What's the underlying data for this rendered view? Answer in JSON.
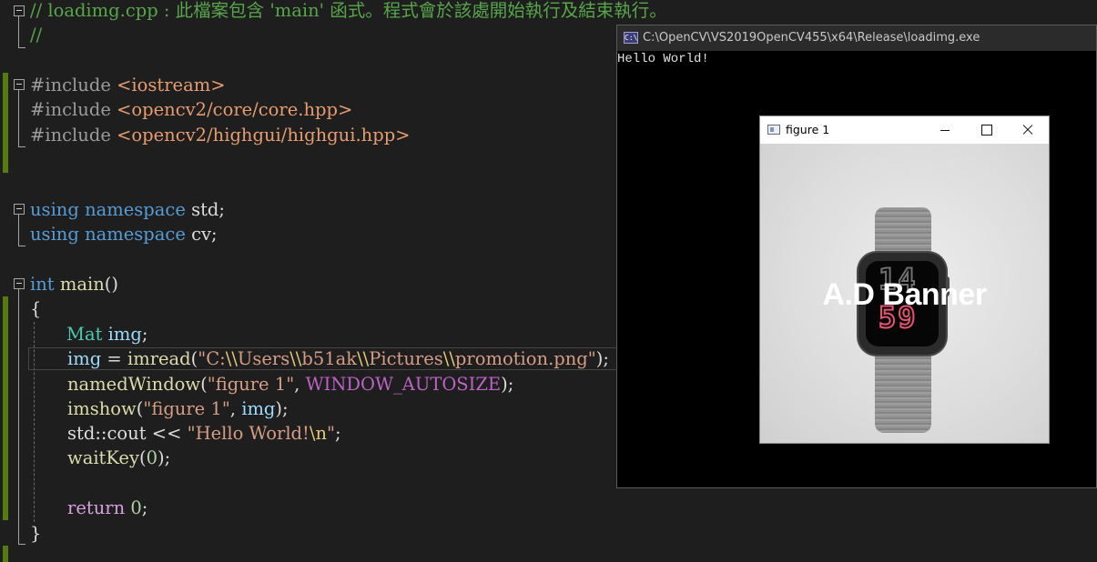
{
  "editor": {
    "lines": {
      "l1_comment": "// loadimg.cpp : 此檔案包含 'main' 函式。程式會於該處開始執行及結束執行。",
      "l2_comment": "//",
      "l3_directive": "#include",
      "l3_header": "<iostream>",
      "l4_directive": "#include",
      "l4_header": "<opencv2/core/core.hpp>",
      "l5_directive": "#include",
      "l5_header": "<opencv2/highgui/highgui.hpp>",
      "l6_kw1": "using",
      "l6_kw2": "namespace",
      "l6_ns": "std;",
      "l7_kw1": "using",
      "l7_kw2": "namespace",
      "l7_ns": "cv;",
      "l8_type": "int",
      "l8_fn": "main",
      "l8_rest": "()",
      "l9_brace": "{",
      "l10_type": "Mat",
      "l10_var": "img",
      "l10_end": ";",
      "l11_var": "img",
      "l11_op": " = ",
      "l11_fn": "imread",
      "l11_open": "(",
      "l11_s1": "\"C:",
      "l11_e1": "\\\\",
      "l11_s2": "Users",
      "l11_e2": "\\\\",
      "l11_s3": "b51ak",
      "l11_e3": "\\\\",
      "l11_s4": "Pictures",
      "l11_e4": "\\\\",
      "l11_s5": "promotion.png\"",
      "l11_close": ");",
      "l12_fn": "namedWindow",
      "l12_open": "(",
      "l12_str": "\"figure 1\"",
      "l12_comma": ", ",
      "l12_macro": "WINDOW_AUTOSIZE",
      "l12_close": ");",
      "l13_fn": "imshow",
      "l13_open": "(",
      "l13_str": "\"figure 1\"",
      "l13_comma": ", ",
      "l13_var": "img",
      "l13_close": ");",
      "l14_prefix": "std::",
      "l14_var": "cout",
      "l14_op": " << ",
      "l14_str": "\"Hello World!",
      "l14_esc": "\\n",
      "l14_strend": "\"",
      "l14_end": ";",
      "l15_fn": "waitKey",
      "l15_open": "(",
      "l15_num": "0",
      "l15_close": ");",
      "l17_kw": "return",
      "l17_num": "0",
      "l17_end": ";",
      "l18_brace": "}"
    }
  },
  "console": {
    "title": "C:\\OpenCV\\VS2019OpenCV455\\x64\\Release\\loadimg.exe",
    "icon_text": "C:\\",
    "output": "Hello World!"
  },
  "figure": {
    "title": "figure 1",
    "banner_text": "A.D Banner",
    "watch_hour": "14",
    "watch_minute": "59"
  },
  "colors": {
    "comment": "#57a64a",
    "keyword": "#569cd6",
    "string": "#d69d85",
    "change_bar": "#587c0c"
  }
}
